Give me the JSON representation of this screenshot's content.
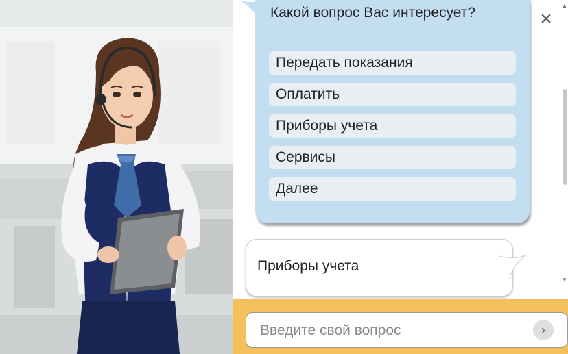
{
  "chat": {
    "bot_question": "Какой вопрос Вас интересует?",
    "options": [
      {
        "label": "Передать показания"
      },
      {
        "label": "Оплатить"
      },
      {
        "label": "Приборы учета"
      },
      {
        "label": "Сервисы"
      },
      {
        "label": "Далее"
      }
    ],
    "user_message": "Приборы учета",
    "close_icon": "×",
    "send_icon": "›"
  },
  "input": {
    "placeholder": "Введите свой вопрос"
  },
  "colors": {
    "bot_bubble": "#c3def1",
    "option_bg": "#e9eef2",
    "input_bar": "#f5bf5c"
  },
  "icons": [
    "close-icon",
    "send-icon",
    "scroll-up-arrow",
    "scroll-down-arrow",
    "bubble-tail"
  ]
}
